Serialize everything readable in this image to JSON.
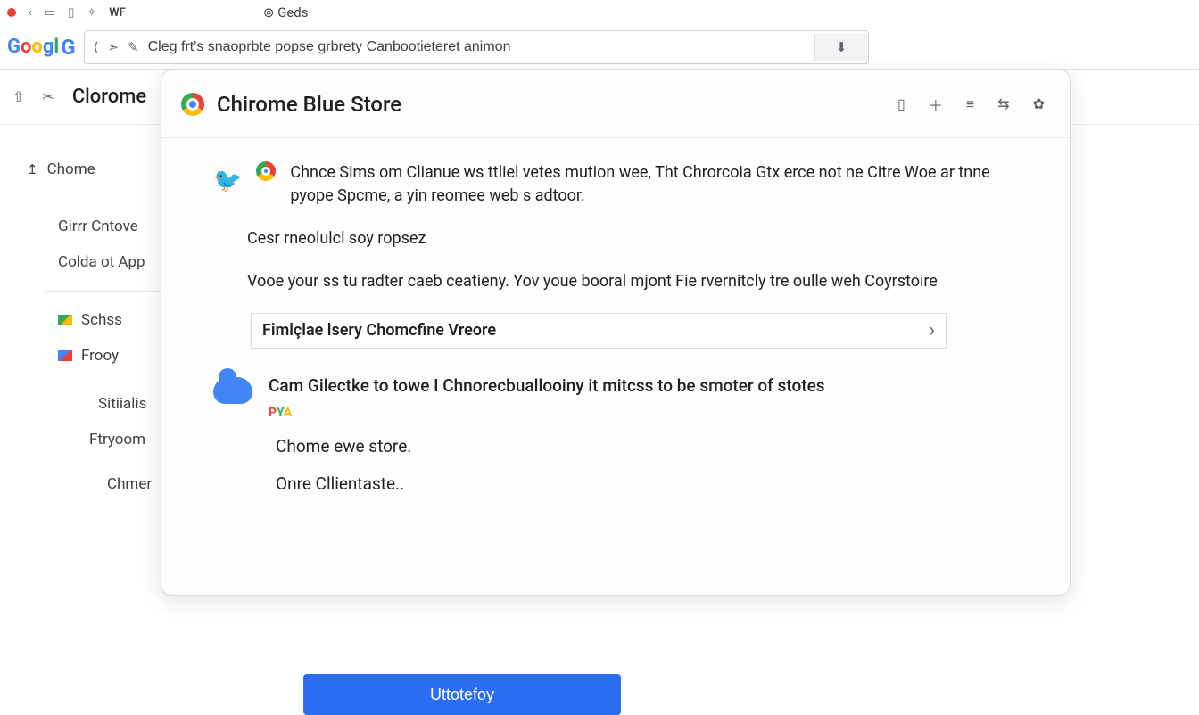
{
  "top": {
    "tab_title": "Geds",
    "w_label": "WF"
  },
  "omnibox": {
    "url_text": "Cleg frt's snaoprbte popse grbrety Canbootieteret animon"
  },
  "header": {
    "app_label": "Clorome"
  },
  "sidebar": {
    "home": "Chome",
    "items": [
      "Girrr Cntove",
      "Colda ot App",
      "Schss",
      "Frooy",
      "Sitiialis",
      "Ftryoom",
      "Chmer"
    ]
  },
  "dialog": {
    "title": "Chirome Blue Store",
    "intro": "Chnce Sims om Clianue ws ttliel vetes mution wee, Tht Chrorcoia Gtx erce not ne Citre Woe ar tnne pyope Spcme, a yin reomee web s adtoor.",
    "line2": "Cesr rneolulcl soy ropsez",
    "line3": "Vooe your ss tu radter caeb ceatieny. Yov youe booral mjont Fie rvernitcly tre oulle weh Coyrstoire",
    "search_label": "Fimlçlae lsery Chomcfine Vreore",
    "cloud_line": "Cam Gilectke to towe I Chnorecbuallooiny it mitcss to be smoter of stotes",
    "sublist": [
      "Chome ewe store.",
      "Onre Cllientaste.."
    ]
  },
  "button": {
    "label": "Uttotefoy"
  }
}
